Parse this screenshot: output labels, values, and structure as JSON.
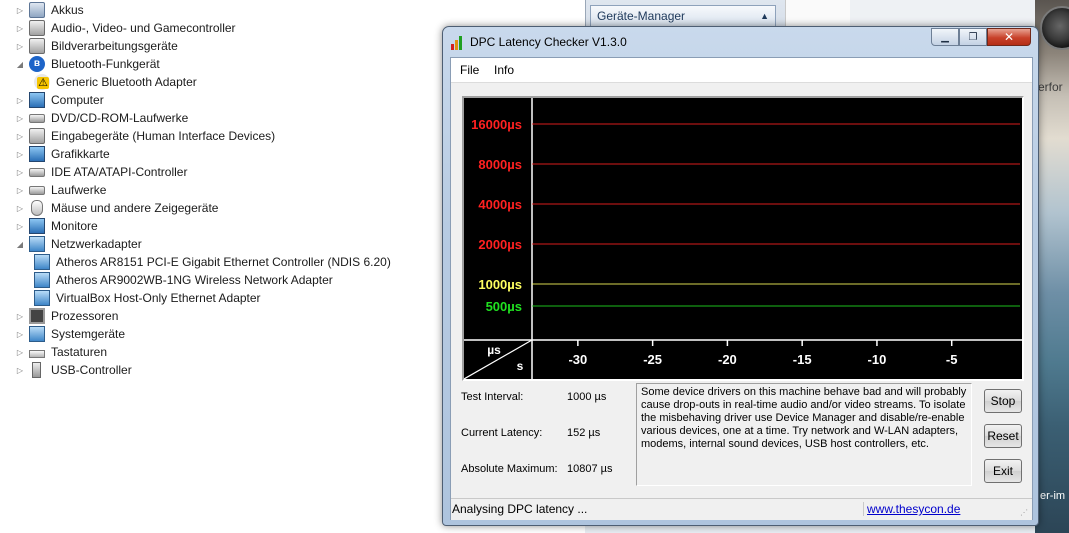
{
  "device_manager": {
    "items": [
      {
        "label": "Akkus",
        "level": 0,
        "expanded": false,
        "icon": "battery-icon"
      },
      {
        "label": "Audio-, Video- und Gamecontroller",
        "level": 0,
        "expanded": false,
        "icon": "speaker-icon"
      },
      {
        "label": "Bildverarbeitungsgeräte",
        "level": 0,
        "expanded": false,
        "icon": "scanner-icon"
      },
      {
        "label": "Bluetooth-Funkgerät",
        "level": 0,
        "expanded": true,
        "icon": "bluetooth-icon"
      },
      {
        "label": "Generic Bluetooth Adapter",
        "level": 1,
        "icon": "bluetooth-warning-icon"
      },
      {
        "label": "Computer",
        "level": 0,
        "expanded": false,
        "icon": "computer-icon"
      },
      {
        "label": "DVD/CD-ROM-Laufwerke",
        "level": 0,
        "expanded": false,
        "icon": "disc-drive-icon"
      },
      {
        "label": "Eingabegeräte (Human Interface Devices)",
        "level": 0,
        "expanded": false,
        "icon": "hid-icon"
      },
      {
        "label": "Grafikkarte",
        "level": 0,
        "expanded": false,
        "icon": "display-adapter-icon"
      },
      {
        "label": "IDE ATA/ATAPI-Controller",
        "level": 0,
        "expanded": false,
        "icon": "ide-controller-icon"
      },
      {
        "label": "Laufwerke",
        "level": 0,
        "expanded": false,
        "icon": "disk-drive-icon"
      },
      {
        "label": "Mäuse und andere Zeigegeräte",
        "level": 0,
        "expanded": false,
        "icon": "mouse-icon"
      },
      {
        "label": "Monitore",
        "level": 0,
        "expanded": false,
        "icon": "monitor-icon"
      },
      {
        "label": "Netzwerkadapter",
        "level": 0,
        "expanded": true,
        "icon": "network-adapter-icon"
      },
      {
        "label": "Atheros AR8151 PCI-E Gigabit Ethernet Controller (NDIS 6.20)",
        "level": 1,
        "icon": "network-adapter-icon"
      },
      {
        "label": "Atheros AR9002WB-1NG Wireless Network Adapter",
        "level": 1,
        "icon": "network-adapter-icon"
      },
      {
        "label": "VirtualBox Host-Only Ethernet Adapter",
        "level": 1,
        "icon": "network-adapter-icon"
      },
      {
        "label": "Prozessoren",
        "level": 0,
        "expanded": false,
        "icon": "processor-icon"
      },
      {
        "label": "Systemgeräte",
        "level": 0,
        "expanded": false,
        "icon": "system-device-icon"
      },
      {
        "label": "Tastaturen",
        "level": 0,
        "expanded": false,
        "icon": "keyboard-icon"
      },
      {
        "label": "USB-Controller",
        "level": 0,
        "expanded": false,
        "icon": "usb-icon"
      }
    ]
  },
  "background": {
    "panel_title": "Geräte-Manager",
    "right_text_1": "erfor",
    "right_text_2": "er-im"
  },
  "window": {
    "title": "DPC Latency Checker V1.3.0",
    "menu": {
      "file": "File",
      "info": "Info"
    },
    "controls": {
      "minimize": "▁",
      "maximize": "❐",
      "close": "✕"
    }
  },
  "chart_data": {
    "type": "bar",
    "unit_corner_top": "µs",
    "unit_corner_bottom": "s",
    "y_reference_lines": [
      {
        "label": "16000µs",
        "value": 16000,
        "color": "#ff2020"
      },
      {
        "label": "8000µs",
        "value": 8000,
        "color": "#ff2020"
      },
      {
        "label": "4000µs",
        "value": 4000,
        "color": "#ff2020"
      },
      {
        "label": "2000µs",
        "value": 2000,
        "color": "#ff2020"
      },
      {
        "label": "1000µs",
        "value": 1000,
        "color": "#ffff60"
      },
      {
        "label": "500µs",
        "value": 500,
        "color": "#20e020"
      }
    ],
    "x_ticks": [
      {
        "label": "-30",
        "value": -30
      },
      {
        "label": "-25",
        "value": -25
      },
      {
        "label": "-20",
        "value": -20
      },
      {
        "label": "-15",
        "value": -15
      },
      {
        "label": "-10",
        "value": -10
      },
      {
        "label": "-5",
        "value": -5
      }
    ],
    "xlim": [
      -33,
      -0.5
    ],
    "bar_color": "#18f018",
    "values": [
      150,
      155,
      150,
      152,
      150,
      155,
      150,
      152,
      158,
      152,
      150,
      152,
      150,
      155,
      150,
      148,
      150,
      152,
      155,
      150,
      152,
      150,
      155,
      152,
      150,
      152,
      150,
      150,
      155,
      155,
      152,
      150,
      148,
      150,
      152,
      158,
      150,
      148,
      152,
      155,
      150,
      148,
      152,
      150,
      150,
      150,
      148,
      150,
      148,
      150,
      152,
      155,
      150,
      148,
      150,
      150,
      150,
      148,
      150,
      148,
      152,
      152,
      150,
      152,
      152
    ]
  },
  "stats": {
    "interval_label": "Test Interval:",
    "interval_value": "1000 µs",
    "current_label": "Current Latency:",
    "current_value": "152 µs",
    "absmax_label": "Absolute Maximum:",
    "absmax_value": "10807 µs"
  },
  "message": "Some device drivers on this machine behave bad and will probably cause drop-outs in real-time audio and/or video streams. To isolate the misbehaving driver use Device Manager and disable/re-enable various devices, one at a time. Try network and W-LAN adapters, modems, internal sound devices, USB host controllers, etc.",
  "buttons": {
    "stop": "Stop",
    "reset": "Reset",
    "exit": "Exit"
  },
  "status": {
    "text": "Analysing DPC latency ...",
    "link": "www.thesycon.de"
  }
}
